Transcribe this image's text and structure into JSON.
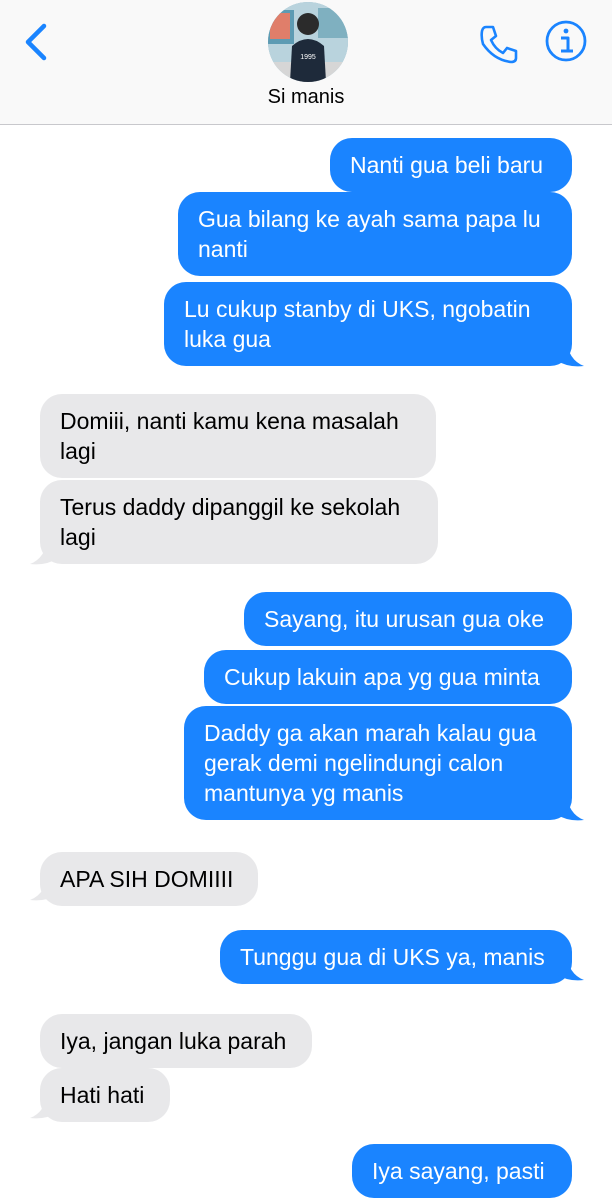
{
  "header": {
    "contact_name": "Si manis",
    "avatar_text": "1995",
    "accent_color": "#1a84ff",
    "icons": [
      "chevron-left-icon",
      "phone-icon",
      "info-icon"
    ]
  },
  "messages": [
    {
      "direction": "outgoing",
      "text": "Nanti gua beli baru"
    },
    {
      "direction": "outgoing",
      "text": "Gua bilang ke ayah sama papa lu nanti"
    },
    {
      "direction": "outgoing",
      "text": "Lu cukup stanby di UKS, ngobatin luka gua"
    },
    {
      "direction": "incoming",
      "text": "Domiii, nanti kamu kena masalah lagi"
    },
    {
      "direction": "incoming",
      "text": "Terus daddy dipanggil ke sekolah lagi"
    },
    {
      "direction": "outgoing",
      "text": "Sayang, itu urusan gua oke"
    },
    {
      "direction": "outgoing",
      "text": "Cukup lakuin apa yg gua minta"
    },
    {
      "direction": "outgoing",
      "text": "Daddy ga akan marah kalau gua gerak demi ngelindungi calon mantunya yg manis"
    },
    {
      "direction": "incoming",
      "text": "APA SIH DOMIIII"
    },
    {
      "direction": "outgoing",
      "text": "Tunggu gua di UKS ya, manis"
    },
    {
      "direction": "incoming",
      "text": "Iya, jangan luka parah"
    },
    {
      "direction": "incoming",
      "text": "Hati hati"
    },
    {
      "direction": "outgoing",
      "text": "Iya sayang, pasti"
    }
  ]
}
